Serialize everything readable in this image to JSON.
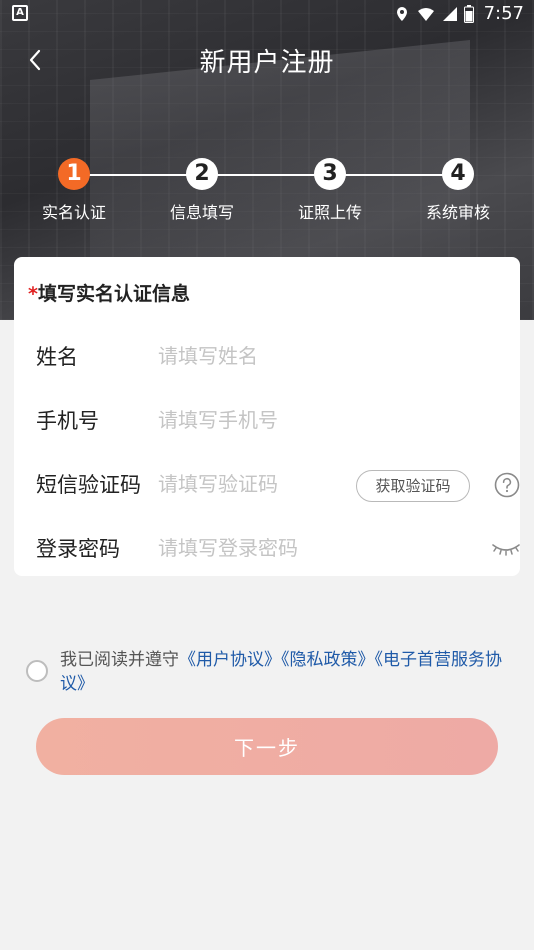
{
  "status_bar": {
    "time": "7:57",
    "notification": "A"
  },
  "header": {
    "title": "新用户注册"
  },
  "steps": [
    {
      "number": "1",
      "label": "实名认证",
      "active": true
    },
    {
      "number": "2",
      "label": "信息填写",
      "active": false
    },
    {
      "number": "3",
      "label": "证照上传",
      "active": false
    },
    {
      "number": "4",
      "label": "系统审核",
      "active": false
    }
  ],
  "form": {
    "required_mark": "*",
    "title": "填写实名认证信息",
    "name": {
      "label": "姓名",
      "placeholder": "请填写姓名",
      "value": ""
    },
    "phone": {
      "label": "手机号",
      "placeholder": "请填写手机号",
      "value": ""
    },
    "sms": {
      "label": "短信验证码",
      "placeholder": "请填写验证码",
      "value": "",
      "button": "获取验证码"
    },
    "password": {
      "label": "登录密码",
      "placeholder": "请填写登录密码",
      "value": ""
    }
  },
  "agreement": {
    "prefix": "我已阅读并遵守",
    "link1": "《用户协议》",
    "link2": "《隐私政策》",
    "link3": "《电子首营服务协议》",
    "checked": false
  },
  "next_button": "下一步",
  "colors": {
    "accent": "#f36a26",
    "link": "#1f5aa8",
    "required": "#e02020",
    "button_bg": "#f0aea2"
  }
}
